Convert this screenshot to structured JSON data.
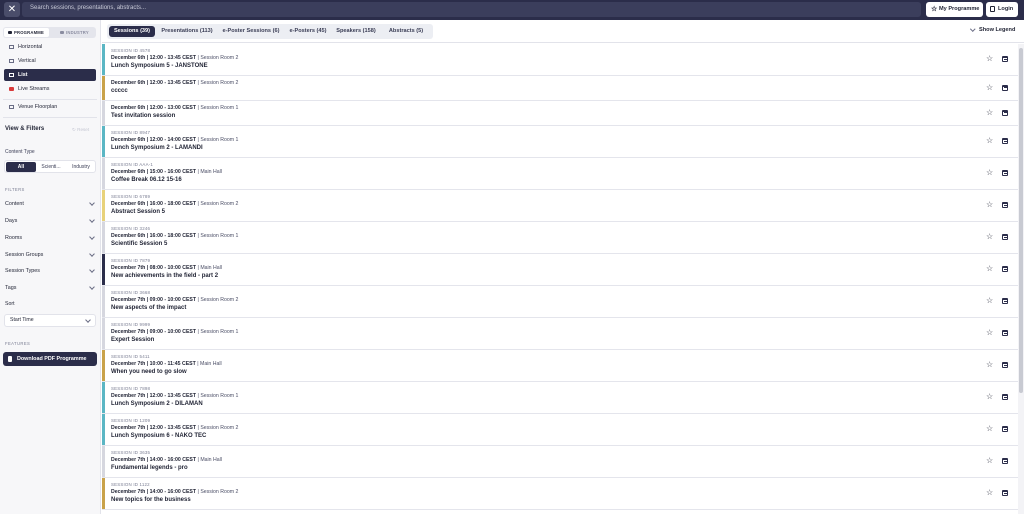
{
  "header": {
    "close_glyph": "✕",
    "search_placeholder": "Search sessions, presentations, abstracts...",
    "my_programme_label": "My Programme",
    "login_label": "Login"
  },
  "sidebar": {
    "tabs": [
      "PROGRAMME",
      "INDUSTRY"
    ],
    "nav": [
      {
        "label": "Horizontal",
        "icon": "horizontal-layout-icon"
      },
      {
        "label": "Vertical",
        "icon": "vertical-layout-icon"
      },
      {
        "label": "List",
        "icon": "list-icon"
      },
      {
        "label": "Live Streams",
        "icon": "live-stream-icon"
      },
      {
        "label": "Venue Floorplan",
        "icon": "floorplan-icon"
      }
    ],
    "view_filters_title": "View & Filters",
    "reset_label": "Reset",
    "content_type_label": "Content Type",
    "content_types": [
      "All",
      "Scienti...",
      "Industry"
    ],
    "filters_heading": "FILTERS",
    "filters": [
      "Content",
      "Days",
      "Rooms",
      "Session Groups",
      "Session Types",
      "Tags"
    ],
    "sort_label": "Sort",
    "sort_value": "Start Time",
    "features_heading": "FEATURES",
    "download_label": "Download PDF Programme"
  },
  "tabs": [
    {
      "label": "Sessions (39)"
    },
    {
      "label": "Presentations (113)"
    },
    {
      "label": "e-Poster Sessions (6)"
    },
    {
      "label": "e-Posters (45)"
    },
    {
      "label": "Speakers (158)"
    },
    {
      "label": "Abstracts (5)"
    }
  ],
  "show_legend_label": "Show Legend",
  "sessions": [
    {
      "id": "SESSION ID 4578",
      "datetime": "December 6th | 12:00 - 13:45 CEST",
      "room": "Session Room 2",
      "title": "Lunch Symposium 5 - JANSTONE",
      "color": "#5bb6c4"
    },
    {
      "id": "",
      "datetime": "December 6th | 12:00 - 13:45 CEST",
      "room": "Session Room 2",
      "title": "ccccc",
      "color": "#c9a24a"
    },
    {
      "id": "",
      "datetime": "December 6th | 12:00 - 13:00 CEST",
      "room": "Session Room 1",
      "title": "Test invitation session",
      "color": "#d6d7df"
    },
    {
      "id": "SESSION ID 8947",
      "datetime": "December 6th | 12:00 - 14:00 CEST",
      "room": "Session Room 1",
      "title": "Lunch Symposium 2 - LAMANDI",
      "color": "#5bb6c4"
    },
    {
      "id": "SESSION ID AAA-1",
      "datetime": "December 6th | 15:00 - 16:00 CEST",
      "room": "Main Hall",
      "title": "Coffee Break 06.12 15-16",
      "color": "#d6d7df"
    },
    {
      "id": "SESSION ID 6789",
      "datetime": "December 6th | 16:00 - 18:00 CEST",
      "room": "Session Room 2",
      "title": "Abstract Session 5",
      "color": "#e8d27a"
    },
    {
      "id": "SESSION ID 3246",
      "datetime": "December 6th | 16:00 - 18:00 CEST",
      "room": "Session Room 1",
      "title": "Scientific Session 5",
      "color": "#d6d7df"
    },
    {
      "id": "SESSION ID 7879",
      "datetime": "December 7th | 08:00 - 10:00 CEST",
      "room": "Main Hall",
      "title": "New achievements in the field - part 2",
      "color": "#2b2d4a"
    },
    {
      "id": "SESSION ID 3668",
      "datetime": "December 7th | 09:00 - 10:00 CEST",
      "room": "Session Room 2",
      "title": "New aspects of the impact",
      "color": "#d6d7df"
    },
    {
      "id": "SESSION ID 9999",
      "datetime": "December 7th | 09:00 - 10:00 CEST",
      "room": "Session Room 1",
      "title": "Expert Session",
      "color": "#d6d7df"
    },
    {
      "id": "SESSION ID 5411",
      "datetime": "December 7th | 10:00 - 11:45 CEST",
      "room": "Main Hall",
      "title": "When you need to go slow",
      "color": "#c9a24a"
    },
    {
      "id": "SESSION ID 7898",
      "datetime": "December 7th | 12:00 - 13:45 CEST",
      "room": "Session Room 1",
      "title": "Lunch Symposium 2 - DILAMAN",
      "color": "#5bb6c4"
    },
    {
      "id": "SESSION ID 1209",
      "datetime": "December 7th | 12:00 - 13:45 CEST",
      "room": "Session Room 2",
      "title": "Lunch Symposium 6 - NAKO TEC",
      "color": "#5bb6c4"
    },
    {
      "id": "SESSION ID 3635",
      "datetime": "December 7th | 14:00 - 16:00 CEST",
      "room": "Main Hall",
      "title": "Fundamental legends - pro",
      "color": "#d6d7df"
    },
    {
      "id": "SESSION ID 1122",
      "datetime": "December 7th | 14:00 - 16:00 CEST",
      "room": "Session Room 2",
      "title": "New topics for the business",
      "color": "#c9a24a"
    }
  ]
}
